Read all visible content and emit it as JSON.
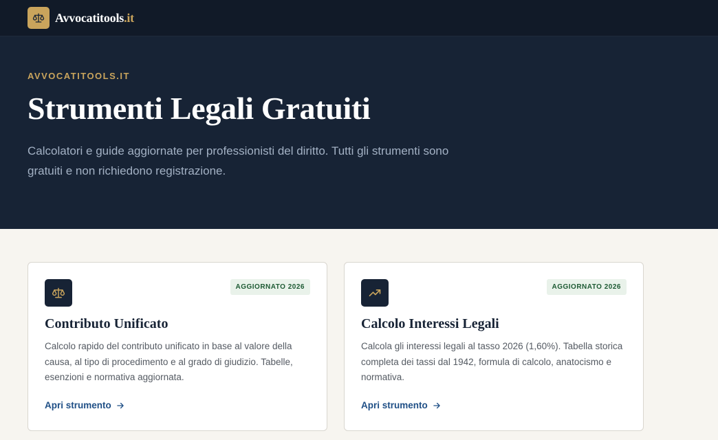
{
  "header": {
    "brand_name": "Avvocatitools",
    "brand_tld": ".it",
    "logo_icon": "scales-icon"
  },
  "hero": {
    "eyebrow": "AVVOCATITOOLS.IT",
    "title": "Strumenti Legali Gratuiti",
    "subtitle": "Calcolatori e guide aggiornate per professionisti del diritto. Tutti gli strumenti sono gratuiti e non richiedono registrazione."
  },
  "cards": [
    {
      "icon": "scales-icon",
      "badge": "AGGIORNATO 2026",
      "title": "Contributo Unificato",
      "description": "Calcolo rapido del contributo unificato in base al valore della causa, al tipo di procedimento e al grado di giudizio. Tabelle, esenzioni e normativa aggiornata.",
      "link_label": "Apri strumento"
    },
    {
      "icon": "trending-up-icon",
      "badge": "AGGIORNATO 2026",
      "title": "Calcolo Interessi Legali",
      "description": "Calcola gli interessi legali al tasso 2026 (1,60%). Tabella storica completa dei tassi dal 1942, formula di calcolo, anatocismo e normativa.",
      "link_label": "Apri strumento"
    }
  ],
  "colors": {
    "navy": "#172335",
    "gold": "#c9a45c",
    "link": "#1f4f86",
    "badge_bg": "#e9f2ea",
    "badge_text": "#1d5a33"
  }
}
